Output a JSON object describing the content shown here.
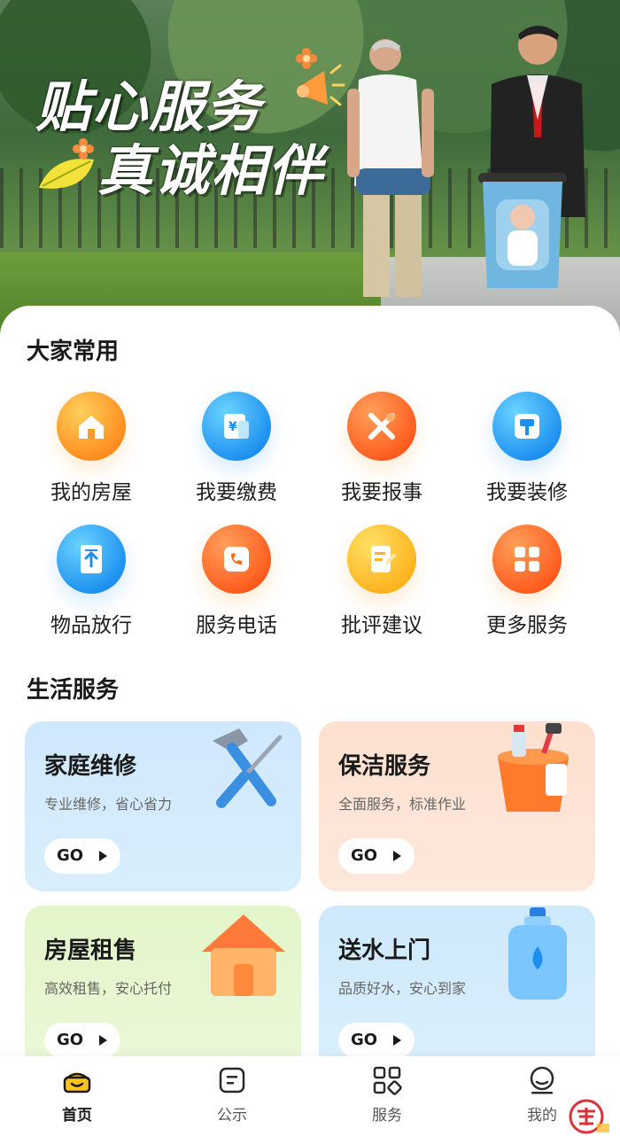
{
  "hero": {
    "slogan_line1": "贴心服务",
    "slogan_line2": "真诚相伴"
  },
  "common": {
    "title": "大家常用",
    "items": [
      {
        "label": "我的房屋",
        "icon": "house-icon",
        "color": "orange"
      },
      {
        "label": "我要缴费",
        "icon": "payment-icon",
        "color": "blue"
      },
      {
        "label": "我要报事",
        "icon": "tools-icon",
        "color": "red"
      },
      {
        "label": "我要装修",
        "icon": "paint-roller-icon",
        "color": "blue"
      },
      {
        "label": "物品放行",
        "icon": "item-release-icon",
        "color": "blue"
      },
      {
        "label": "服务电话",
        "icon": "phone-icon",
        "color": "red"
      },
      {
        "label": "批评建议",
        "icon": "suggestion-icon",
        "color": "yellow"
      },
      {
        "label": "更多服务",
        "icon": "more-services-icon",
        "color": "red"
      }
    ]
  },
  "life": {
    "title": "生活服务",
    "cards": [
      {
        "title": "家庭维修",
        "subtitle": "专业维修，省心省力",
        "go": "GO",
        "icon": "hammer-screwdriver-icon"
      },
      {
        "title": "保洁服务",
        "subtitle": "全面服务，标准作业",
        "go": "GO",
        "icon": "cleaning-bucket-icon"
      },
      {
        "title": "房屋租售",
        "subtitle": "高效租售，安心托付",
        "go": "GO",
        "icon": "house-3d-icon"
      },
      {
        "title": "送水上门",
        "subtitle": "品质好水，安心到家",
        "go": "GO",
        "icon": "water-bottle-icon"
      }
    ]
  },
  "nav": {
    "items": [
      {
        "label": "首页",
        "icon": "home-icon",
        "active": true
      },
      {
        "label": "公示",
        "icon": "notice-icon",
        "active": false
      },
      {
        "label": "服务",
        "icon": "services-icon",
        "active": false
      },
      {
        "label": "我的",
        "icon": "profile-icon",
        "active": false
      }
    ]
  },
  "colors": {
    "accent_orange": "#ff8a1c",
    "accent_blue": "#1c8ff0",
    "active_nav": "#ffc21c"
  }
}
